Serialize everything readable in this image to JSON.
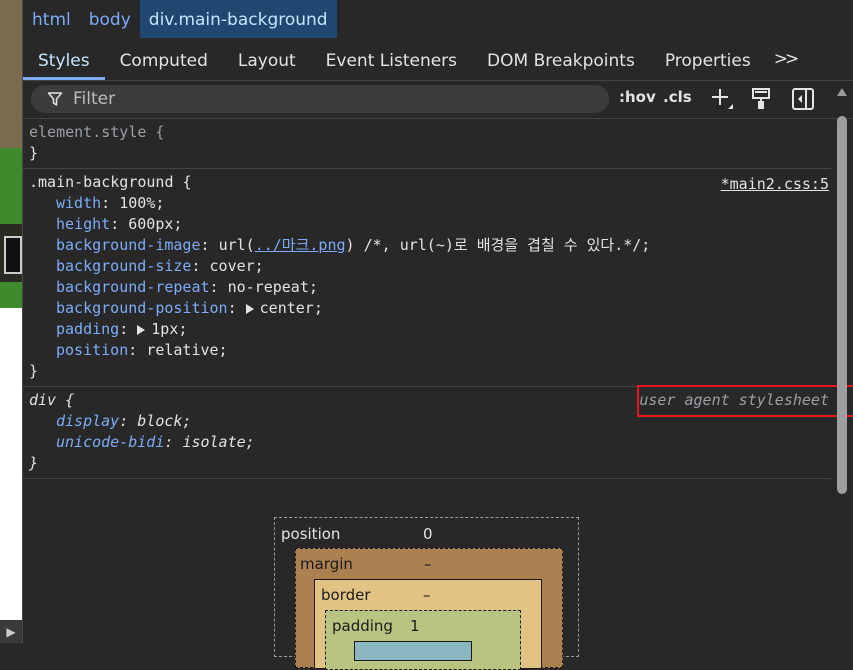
{
  "breadcrumbs": [
    "html",
    "body",
    "div.main-background"
  ],
  "tabs": [
    "Styles",
    "Computed",
    "Layout",
    "Event Listeners",
    "DOM Breakpoints",
    "Properties"
  ],
  "tab_more": ">>",
  "filter": {
    "placeholder": "Filter"
  },
  "toolbar": {
    "hov": ":hov",
    "cls": ".cls"
  },
  "rules": {
    "element_style": {
      "open": "element.style {",
      "close": "}"
    },
    "main": {
      "selector": ".main-background {",
      "source": "*main2.css:5",
      "width": {
        "name": "width",
        "value": "100%;"
      },
      "height": {
        "name": "height",
        "value": "600px;"
      },
      "bg_image": {
        "name": "background-image",
        "url_prefix": "url(",
        "url_link": "../마크.png",
        "url_suffix": ") /*, url(~)로 배경을 겹칠 수 있다.*/;"
      },
      "bg_size": {
        "name": "background-size",
        "value": "cover;"
      },
      "bg_repeat": {
        "name": "background-repeat",
        "value": "no-repeat;"
      },
      "bg_position": {
        "name": "background-position",
        "value": "center;"
      },
      "padding": {
        "name": "padding",
        "value": "1px;"
      },
      "position": {
        "name": "position",
        "value": "relative;"
      },
      "close": "}"
    },
    "div": {
      "selector": "div {",
      "source": "user agent stylesheet",
      "display": {
        "name": "display",
        "value": "block;"
      },
      "unicode_bidi": {
        "name": "unicode-bidi",
        "value": "isolate;"
      },
      "close": "}"
    }
  },
  "box_model": {
    "position_label": "position",
    "position_value": "0",
    "margin_label": "margin",
    "margin_value": "–",
    "border_label": "border",
    "border_value": "–",
    "padding_label": "padding",
    "padding_value": "1"
  },
  "colors": {
    "accent": "#7cacf8",
    "highlight_box": "#e5161d",
    "panel_bg": "#282828"
  },
  "icons": [
    "filter-icon",
    "plus-icon",
    "paint-brush-icon",
    "sidebar-toggle-icon",
    "triangle-right-icon",
    "scroll-up-icon"
  ]
}
